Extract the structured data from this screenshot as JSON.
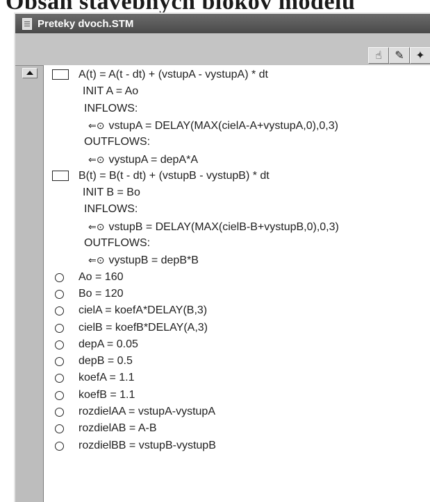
{
  "page_heading": "Obsah stavebných blokov modelu",
  "window": {
    "title": "Preteky dvoch.STM"
  },
  "toolbar": {
    "tools": [
      {
        "name": "hand-tool",
        "glyph": "☝"
      },
      {
        "name": "brush-tool",
        "glyph": "✎"
      },
      {
        "name": "wand-tool",
        "glyph": "✦"
      }
    ]
  },
  "equations": [
    {
      "kind": "stock",
      "text": "A(t) = A(t - dt) + (vstupA - vystupA) * dt"
    },
    {
      "kind": "init",
      "text": "INIT A = Ao"
    },
    {
      "kind": "section",
      "text": "INFLOWS:"
    },
    {
      "kind": "flow",
      "text": "vstupA = DELAY(MAX(cielA-A+vystupA,0),0,3)"
    },
    {
      "kind": "section",
      "text": "OUTFLOWS:"
    },
    {
      "kind": "flow",
      "text": "vystupA = depA*A"
    },
    {
      "kind": "stock",
      "text": "B(t) = B(t - dt) + (vstupB - vystupB) * dt"
    },
    {
      "kind": "init",
      "text": "INIT B = Bo"
    },
    {
      "kind": "section",
      "text": "INFLOWS:"
    },
    {
      "kind": "flow",
      "text": "vstupB = DELAY(MAX(cielB-B+vystupB,0),0,3)"
    },
    {
      "kind": "section",
      "text": "OUTFLOWS:"
    },
    {
      "kind": "flow",
      "text": "vystupB = depB*B"
    },
    {
      "kind": "converter",
      "text": "Ao = 160"
    },
    {
      "kind": "converter",
      "text": "Bo = 120"
    },
    {
      "kind": "converter",
      "text": "cielA = koefA*DELAY(B,3)"
    },
    {
      "kind": "converter",
      "text": "cielB = koefB*DELAY(A,3)"
    },
    {
      "kind": "converter",
      "text": "depA = 0.05"
    },
    {
      "kind": "converter",
      "text": "depB = 0.5"
    },
    {
      "kind": "converter",
      "text": "koefA = 1.1"
    },
    {
      "kind": "converter",
      "text": "koefB = 1.1"
    },
    {
      "kind": "converter",
      "text": "rozdielAA = vstupA-vystupA"
    },
    {
      "kind": "converter",
      "text": "rozdielAB = A-B"
    },
    {
      "kind": "converter",
      "text": "rozdielBB = vstupB-vystupB"
    }
  ]
}
